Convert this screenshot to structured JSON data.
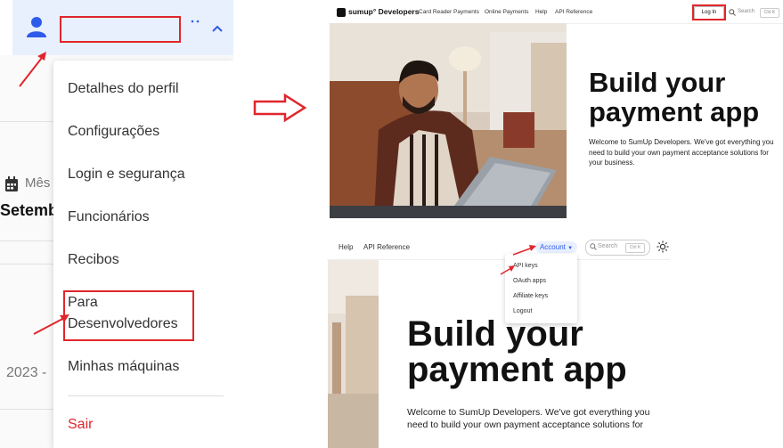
{
  "dashboard": {
    "month_label": "Mês",
    "month_value": "Setembro",
    "year_value": "2023 -",
    "more_icon": "more-horizontal-icon",
    "chevron_icon": "chevron-up-icon",
    "avatar_icon": "user-icon"
  },
  "profile_menu": {
    "items": [
      "Detalhes do perfil",
      "Configurações",
      "Login e segurança",
      "Funcionários",
      "Recibos",
      "Para Desenvolvedores",
      "Minhas máquinas"
    ],
    "logout": "Sair",
    "logout_color": "#e0262c"
  },
  "dev_page_top": {
    "brand": "sumup° Developers",
    "nav": [
      "Card Reader Payments",
      "Online Payments",
      "Help",
      "API Reference"
    ],
    "login": "Log In",
    "search": "Search",
    "search_kbd": "Ctrl K",
    "heading": "Build your payment app",
    "intro": "Welcome to SumUp Developers. We've got everything you need to build your own payment acceptance solutions for your business."
  },
  "dev_page_bottom": {
    "nav": [
      "Help",
      "API Reference"
    ],
    "account": "Account",
    "search": "Search",
    "search_kbd": "Ctrl K",
    "theme_icon": "sun-icon",
    "heading": "Build your payment app",
    "intro": "Welcome to SumUp Developers. We've got everything you need to build your own payment acceptance solutions for",
    "account_menu": [
      "API keys",
      "OAuth apps",
      "Affiliate keys",
      "Logout"
    ]
  },
  "colors": {
    "annotation_red": "#e0262c",
    "accent_blue": "#2f5bea",
    "top_bar": "#e8f0fd"
  }
}
